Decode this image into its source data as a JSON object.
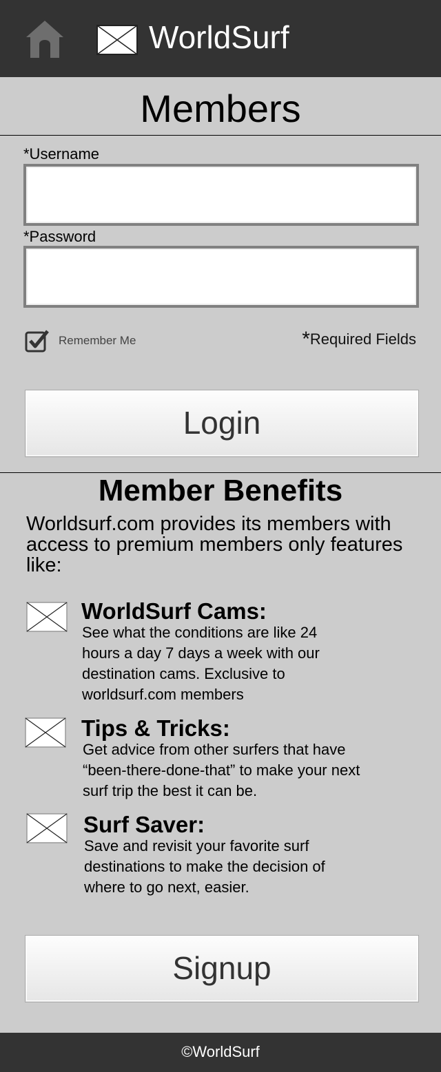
{
  "header": {
    "home_icon": "home-icon",
    "logo_icon": "image-placeholder-icon",
    "app_title": "WorldSurf"
  },
  "page_title": "Members",
  "login_form": {
    "username_label": "*Username",
    "username_value": "",
    "password_label": "*Password",
    "password_value": "",
    "remember_me_label": "Remember Me",
    "remember_me_checked": true,
    "required_star": "*",
    "required_note": "Required Fields",
    "login_label": "Login"
  },
  "benefits": {
    "title": "Member Benefits",
    "intro": "Worldsurf.com provides its members with access to premium members only features like:",
    "items": [
      {
        "icon": "image-placeholder-icon",
        "title": "WorldSurf Cams:",
        "description": "See what the conditions are like 24 hours a day 7 days a week with our destination cams. Exclusive to worldsurf.com members"
      },
      {
        "icon": "image-placeholder-icon",
        "title": "Tips & Tricks:",
        "description": "Get advice from other surfers that have “been-there-done-that” to make your next surf trip the best it can be."
      },
      {
        "icon": "image-placeholder-icon",
        "title": "Surf Saver:",
        "description": "Save and revisit your favorite surf destinations to make the decision of where to go next, easier."
      }
    ],
    "signup_label": "Signup"
  },
  "footer": {
    "copyright": "©WorldSurf"
  },
  "colors": {
    "header_bg": "#333333",
    "page_bg": "#cccccc",
    "input_border": "#808080",
    "button_text": "#333333"
  }
}
